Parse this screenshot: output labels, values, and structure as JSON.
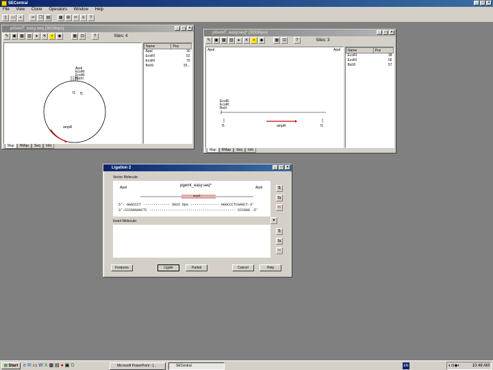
{
  "app": {
    "title": "SECentral"
  },
  "menu": [
    "File",
    "View",
    "Clone",
    "Operators",
    "Window",
    "Help"
  ],
  "map_window": {
    "title": "pGemT_easy.seq (3015bps)",
    "sites": "Sites: 4",
    "labels": {
      "sites": [
        "ApaI",
        "EcoRI",
        "EcoRI",
        "BstXI"
      ],
      "p1": "f1",
      "p2": "f1",
      "gene": "ampR"
    },
    "table": {
      "headers": [
        "Name",
        "Pos"
      ],
      "rows": [
        [
          "ApaI",
          "16"
        ],
        [
          "EcoRI",
          "52"
        ],
        [
          "EcoRI",
          "70"
        ],
        [
          "BstXI",
          "33..."
        ]
      ]
    },
    "tabs": [
      "Map",
      "RMap",
      "Seq",
      "Info"
    ]
  },
  "lin_window": {
    "title": "pGemT_easy.seq* (3015bps)",
    "sites": "Sites: 3",
    "labels": {
      "left": "ApaI",
      "right": "ApaI",
      "stack": [
        "EcoRI",
        "EcoRI",
        "BstX"
      ],
      "f1a": "f1",
      "gene": "ampR",
      "f1b": "f1"
    },
    "table": {
      "headers": [
        "Name",
        "Pos"
      ],
      "rows": [
        [
          "EcoRI",
          "38"
        ],
        [
          "EcoRI",
          "56"
        ],
        [
          "BstXI",
          "57"
        ]
      ]
    },
    "tabs": [
      "Map",
      "RMap",
      "Seq",
      "Info"
    ]
  },
  "ligation": {
    "title": "Ligation 2",
    "vector_label": "Vector Molecule:",
    "seq_name": "pgemt_easy.seq*",
    "left_site": "ApaI",
    "right_site": "ApaI",
    "gene": "ampR",
    "top_seq": "5'-  GGGCCCT ------------- 3015 bps -------------- GGGCCCTCGAGCT-3'",
    "bot_seq": "3'-CCCGGGAGCTC ------------------------------------------ CCCGGG  -5'",
    "insert_label": "Insert Molecule:",
    "buttons": {
      "features": "Features",
      "ligate": "Ligate",
      "partial": "Partial",
      "cancel": "Cancel",
      "help": "Help"
    }
  },
  "taskbar": {
    "start": "Start",
    "tasks": [
      "Microsoft PowerPoint - [...",
      "SECentral"
    ],
    "lang": "EN",
    "clock": "10:48 AM"
  }
}
